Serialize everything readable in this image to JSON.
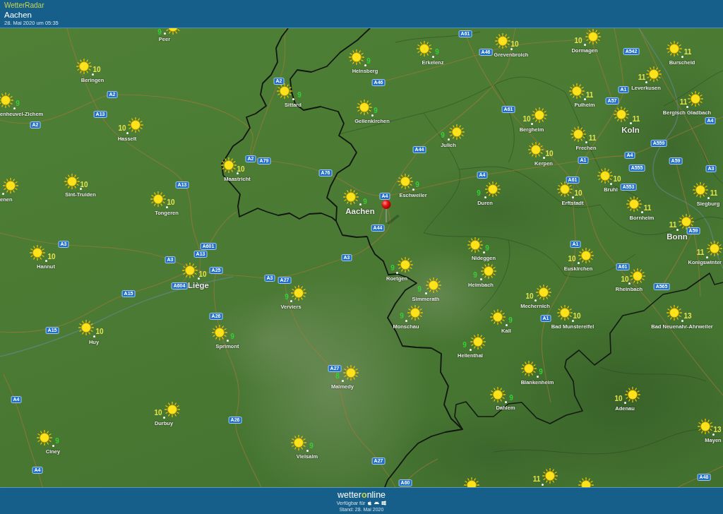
{
  "header": {
    "app_title": "WetterRadar",
    "location": "Aachen",
    "timestamp": "28. Mai 2020 um 05:35"
  },
  "map": {
    "places": [
      {
        "name": "Peer",
        "kind": "town",
        "temperature": "9",
        "color": "#35d035"
      },
      {
        "name": "Heinsberg",
        "kind": "town",
        "temperature": "9",
        "color": "#35d035"
      },
      {
        "name": "Erkelenz",
        "kind": "town",
        "temperature": "9",
        "color": "#35d035"
      },
      {
        "name": "Grevenbroich",
        "kind": "town",
        "temperature": "10",
        "color": "#e3e34b"
      },
      {
        "name": "Dormagen",
        "kind": "town",
        "temperature": "10",
        "color": "#e3e34b"
      },
      {
        "name": "Burscheid",
        "kind": "town",
        "temperature": "11",
        "color": "#e3e34b"
      },
      {
        "name": "Beringen",
        "kind": "town",
        "temperature": "10",
        "color": "#e3e34b"
      },
      {
        "name": "Leverkusen",
        "kind": "town",
        "temperature": "11",
        "color": "#e3e34b"
      },
      {
        "name": "Sittard",
        "kind": "town",
        "temperature": "9",
        "color": "#35d035"
      },
      {
        "name": "Pulheim",
        "kind": "town",
        "temperature": "11",
        "color": "#e3e34b"
      },
      {
        "name": "enheuvel-Zichem",
        "kind": "town",
        "temperature": "9",
        "color": "#35d035"
      },
      {
        "name": "Bergisch Gladbach",
        "kind": "town",
        "temperature": "11",
        "color": "#e3e34b"
      },
      {
        "name": "Geilenkirchen",
        "kind": "town",
        "temperature": "9",
        "color": "#35d035"
      },
      {
        "name": "Bergheim",
        "kind": "town",
        "temperature": "10",
        "color": "#e3e34b"
      },
      {
        "name": "Koln",
        "kind": "city",
        "temperature": "11",
        "color": "#e3e34b"
      },
      {
        "name": "Hasselt",
        "kind": "town",
        "temperature": "10",
        "color": "#e3e34b"
      },
      {
        "name": "Julich",
        "kind": "town",
        "temperature": "9",
        "color": "#35d035"
      },
      {
        "name": "Frechen",
        "kind": "town",
        "temperature": "11",
        "color": "#e3e34b"
      },
      {
        "name": "Kerpen",
        "kind": "town",
        "temperature": "10",
        "color": "#e3e34b"
      },
      {
        "name": "Maastricht",
        "kind": "town",
        "temperature": "10",
        "color": "#e3e34b"
      },
      {
        "name": "Bruhl",
        "kind": "town",
        "temperature": "10",
        "color": "#e3e34b"
      },
      {
        "name": "Sint-Truiden",
        "kind": "town",
        "temperature": "10",
        "color": "#e3e34b"
      },
      {
        "name": "Eschweiler",
        "kind": "town",
        "temperature": "9",
        "color": "#35d035"
      },
      {
        "name": "enen",
        "kind": "town"
      },
      {
        "name": "Duren",
        "kind": "town",
        "temperature": "9",
        "color": "#35d035"
      },
      {
        "name": "Erftstadt",
        "kind": "town",
        "temperature": "10",
        "color": "#e3e34b"
      },
      {
        "name": "Siegburg",
        "kind": "town",
        "temperature": "11",
        "color": "#e3e34b"
      },
      {
        "name": "Tongeren",
        "kind": "town",
        "temperature": "10",
        "color": "#e3e34b"
      },
      {
        "name": "Aachen",
        "kind": "city",
        "temperature": "9",
        "color": "#35d035"
      },
      {
        "name": "Bornheim",
        "kind": "town",
        "temperature": "11",
        "color": "#e3e34b"
      },
      {
        "name": "Bonn",
        "kind": "city",
        "temperature": "11",
        "color": "#e3e34b"
      },
      {
        "name": "Nideggen",
        "kind": "town",
        "temperature": "9",
        "color": "#35d035"
      },
      {
        "name": "Konigswinter",
        "kind": "town",
        "temperature": "11",
        "color": "#e3e34b"
      },
      {
        "name": "Hannut",
        "kind": "town",
        "temperature": "10",
        "color": "#e3e34b"
      },
      {
        "name": "Euskirchen",
        "kind": "town",
        "temperature": "10",
        "color": "#e3e34b"
      },
      {
        "name": "Roetgen",
        "kind": "town",
        "temperature": "9",
        "color": "#35d035"
      },
      {
        "name": "Liège",
        "kind": "city",
        "temperature": "10",
        "color": "#e3e34b"
      },
      {
        "name": "Heimbach",
        "kind": "town",
        "temperature": "9",
        "color": "#35d035"
      },
      {
        "name": "Rheinbach",
        "kind": "town",
        "temperature": "10",
        "color": "#e3e34b"
      },
      {
        "name": "Verviers",
        "kind": "town",
        "temperature": "9",
        "color": "#35d035"
      },
      {
        "name": "Simmerath",
        "kind": "town",
        "temperature": "9",
        "color": "#35d035"
      },
      {
        "name": "Mechernich",
        "kind": "town",
        "temperature": "10",
        "color": "#e3e34b"
      },
      {
        "name": "Monschau",
        "kind": "town",
        "temperature": "9",
        "color": "#35d035"
      },
      {
        "name": "Bad Munstereifel",
        "kind": "town",
        "temperature": "10",
        "color": "#e3e34b"
      },
      {
        "name": "Bad Neuenahr-Ahrweiler",
        "kind": "town",
        "temperature": "13",
        "color": "#e3e34b"
      },
      {
        "name": "Kall",
        "kind": "town",
        "temperature": "9",
        "color": "#35d035"
      },
      {
        "name": "Huy",
        "kind": "town",
        "temperature": "10",
        "color": "#e3e34b"
      },
      {
        "name": "Sprimont",
        "kind": "town",
        "temperature": "9",
        "color": "#35d035"
      },
      {
        "name": "Hellenthal",
        "kind": "town",
        "temperature": "9",
        "color": "#35d035"
      },
      {
        "name": "Blankenheim",
        "kind": "town",
        "temperature": "9",
        "color": "#35d035"
      },
      {
        "name": "Malmedy",
        "kind": "town",
        "temperature": "8",
        "color": "#35d035"
      },
      {
        "name": "Dahlem",
        "kind": "town",
        "temperature": "9",
        "color": "#35d035"
      },
      {
        "name": "Adenau",
        "kind": "town",
        "temperature": "10",
        "color": "#e3e34b"
      },
      {
        "name": "Durbuy",
        "kind": "town",
        "temperature": "10",
        "color": "#e3e34b"
      },
      {
        "name": "Mayen",
        "kind": "town",
        "temperature": "13",
        "color": "#e3e34b"
      },
      {
        "name": "Ciney",
        "kind": "town",
        "temperature": "9",
        "color": "#35d035"
      },
      {
        "name": "Vielsalm",
        "kind": "town",
        "temperature": "9",
        "color": "#35d035"
      },
      {
        "kind": "town",
        "temperature": "11",
        "color": "#e3e34b"
      },
      {
        "kind": "symbol"
      },
      {
        "kind": "symbol"
      }
    ],
    "road_signs": [
      "A61",
      "A542",
      "A46",
      "A2",
      "A46",
      "A1",
      "A2",
      "A57",
      "A61",
      "A13",
      "A4",
      "A2",
      "A559",
      "A44",
      "A4",
      "A2",
      "A79",
      "A1",
      "A59",
      "A555",
      "A3",
      "A76",
      "A4",
      "A61",
      "A13",
      "A553",
      "A4",
      "A44",
      "A59",
      "A3",
      "A1",
      "A601",
      "A13",
      "A3",
      "A3",
      "A61",
      "A25",
      "A3",
      "A27",
      "A604",
      "A565",
      "A15",
      "A26",
      "A1",
      "A15",
      "A27",
      "A4",
      "A26",
      "A27",
      "A4",
      "A48",
      "A60"
    ]
  },
  "footer": {
    "logo": [
      {
        "text": "wetter",
        "highlight": false
      },
      {
        "text": "o",
        "highlight": true
      },
      {
        "text": "nline",
        "highlight": false
      }
    ],
    "availability_label": "Verfügbar für",
    "updated": "Stand: 28. Mai 2020"
  }
}
